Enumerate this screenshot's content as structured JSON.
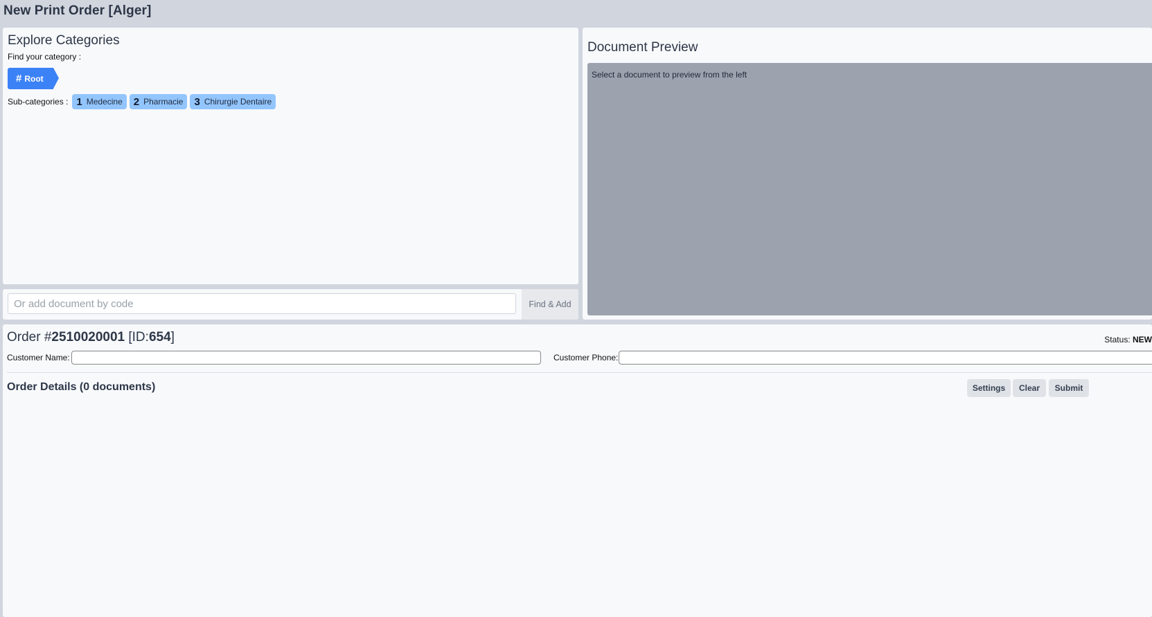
{
  "app": {
    "title": "New Print Order [Alger]"
  },
  "categories": {
    "heading": "Explore Categories",
    "find_label": "Find your category :",
    "breadcrumb": {
      "hash": "#",
      "label": "Root"
    },
    "subcategories_label": "Sub-categories :",
    "subcategories": [
      {
        "num": "1",
        "label": "Medecine"
      },
      {
        "num": "2",
        "label": "Pharmacie"
      },
      {
        "num": "3",
        "label": "Chirurgie Dentaire"
      }
    ]
  },
  "code_search": {
    "placeholder": "Or add document by code",
    "button_label": "Find & Add"
  },
  "preview": {
    "heading": "Document Preview",
    "message": "Select a document to preview from the left"
  },
  "order": {
    "title_prefix": "Order #",
    "number": "2510020001",
    "id_open": " [ID:",
    "id": "654",
    "id_close": "]",
    "status_label": "Status:",
    "status_value": "NEW",
    "customer_name_label": "Customer Name:",
    "customer_phone_label": "Customer Phone:",
    "customer_name_value": "",
    "customer_phone_value": "",
    "details_title": "Order Details (0 documents)",
    "buttons": {
      "settings": "Settings",
      "clear": "Clear",
      "submit": "Submit"
    }
  },
  "colors": {
    "accent": "#3b82f6",
    "chip": "#93c5fd",
    "page_bg": "#d1d5de",
    "panel_bg": "#f8f9fb",
    "preview_bg": "#9ca3ae"
  }
}
